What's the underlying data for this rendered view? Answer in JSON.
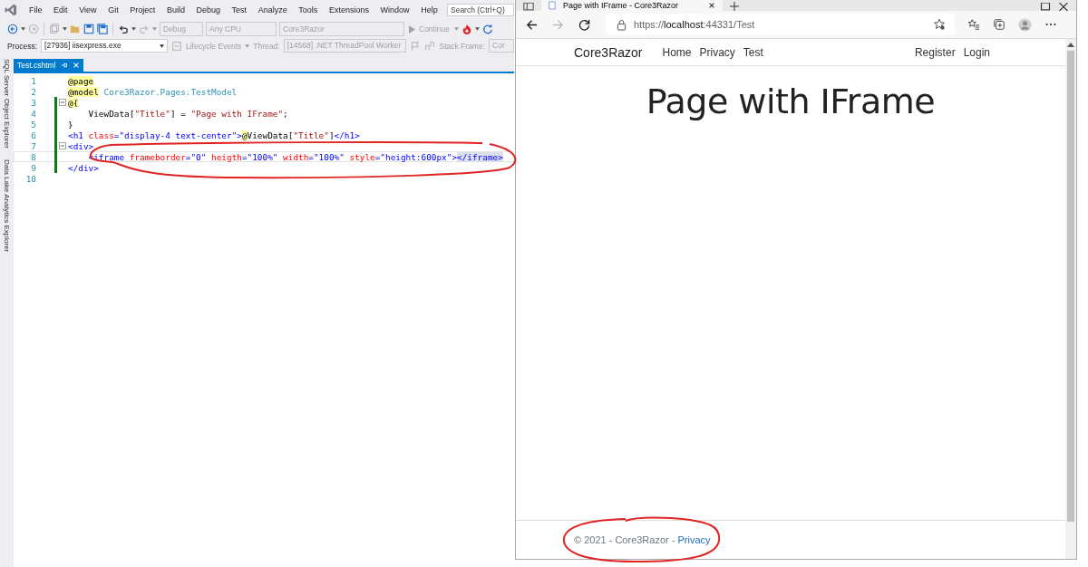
{
  "ide": {
    "menu": [
      "File",
      "Edit",
      "View",
      "Git",
      "Project",
      "Build",
      "Debug",
      "Test",
      "Analyze",
      "Tools",
      "Extensions",
      "Window",
      "Help"
    ],
    "search": {
      "placeholder": "Search (Ctrl+Q)"
    },
    "toolbar": {
      "dropdowns": [
        {
          "label": "Debug",
          "disabled": true
        },
        {
          "label": "Any CPU",
          "disabled": true
        },
        {
          "label": "Core3Razor",
          "disabled": true
        }
      ],
      "continue": {
        "label": "Continue",
        "disabled": true
      }
    },
    "debug_bar": {
      "process_label": "Process:",
      "process": "[27936] iisexpress.exe",
      "lifecycle": "Lifecycle Events",
      "thread_label": "Thread:",
      "thread": "[14568] .NET ThreadPool Worker",
      "stack_label": "Stack Frame:",
      "stack": "Cor"
    },
    "side_panels": [
      "SQL Server Object Explorer",
      "Data Lake Analytics Explorer"
    ],
    "tabs": [
      {
        "label": "Test.cshtml",
        "selected": true
      }
    ],
    "lines": [
      {
        "number": "1",
        "modified": false,
        "fold": false,
        "current": false,
        "tokens": [
          {
            "text": "@page",
            "kind": "razor"
          }
        ]
      },
      {
        "number": "2",
        "modified": false,
        "fold": false,
        "current": false,
        "tokens": [
          {
            "text": "@model",
            "kind": "razor"
          },
          {
            "text": " Core3Razor.Pages.TestModel",
            "kind": "type"
          }
        ]
      },
      {
        "number": "3",
        "modified": true,
        "fold": true,
        "current": false,
        "tokens": [
          {
            "text": "@{",
            "kind": "razor"
          }
        ]
      },
      {
        "number": "4",
        "modified": true,
        "fold": false,
        "current": false,
        "tokens": [
          {
            "text": "    ViewData[",
            "kind": "plain"
          },
          {
            "text": "\"Title\"",
            "kind": "string"
          },
          {
            "text": "] = ",
            "kind": "plain"
          },
          {
            "text": "\"Page with IFrame\"",
            "kind": "string"
          },
          {
            "text": ";",
            "kind": "plain"
          }
        ]
      },
      {
        "number": "5",
        "modified": true,
        "fold": false,
        "current": false,
        "tokens": [
          {
            "text": "}",
            "kind": "plain"
          }
        ]
      },
      {
        "number": "6",
        "modified": true,
        "fold": false,
        "current": false,
        "tokens": [
          {
            "text": "<h1 ",
            "kind": "tag"
          },
          {
            "text": "class",
            "kind": "attr"
          },
          {
            "text": "=\"display-4 text-center\">",
            "kind": "tag"
          },
          {
            "text": "@",
            "kind": "razor"
          },
          {
            "text": "ViewData[",
            "kind": "plain"
          },
          {
            "text": "\"Title\"",
            "kind": "string"
          },
          {
            "text": "]",
            "kind": "plain"
          },
          {
            "text": "</h1>",
            "kind": "tag"
          }
        ]
      },
      {
        "number": "7",
        "modified": true,
        "fold": true,
        "current": false,
        "tokens": [
          {
            "text": "<div>",
            "kind": "tag"
          }
        ]
      },
      {
        "number": "8",
        "modified": true,
        "fold": false,
        "current": true,
        "tokens": [
          {
            "text": "    <iframe ",
            "kind": "tag"
          },
          {
            "text": "frameborder",
            "kind": "attr"
          },
          {
            "text": "=\"0\" ",
            "kind": "tag"
          },
          {
            "text": "heigth",
            "kind": "attr"
          },
          {
            "text": "=\"100%\" ",
            "kind": "tag"
          },
          {
            "text": "width",
            "kind": "attr"
          },
          {
            "text": "=\"100%\" ",
            "kind": "tag"
          },
          {
            "text": "style",
            "kind": "attr"
          },
          {
            "text": "=\"height:600px\">",
            "kind": "tag"
          },
          {
            "text": "</iframe>",
            "kind": "match"
          }
        ]
      },
      {
        "number": "9",
        "modified": true,
        "fold": false,
        "current": false,
        "tokens": [
          {
            "text": "</div>",
            "kind": "tag"
          }
        ]
      },
      {
        "number": "10",
        "modified": false,
        "fold": false,
        "current": false
      }
    ]
  },
  "browser": {
    "tab_title": "Page with IFrame - Core3Razor",
    "url_scheme": "https://",
    "url_host": "localhost",
    "url_path": ":44331/Test",
    "brand": "Core3Razor",
    "nav": [
      "Home",
      "Privacy",
      "Test"
    ],
    "nav_right": [
      "Register",
      "Login"
    ],
    "heading": "Page with IFrame",
    "footer": "© 2021 - Core3Razor - ",
    "footer_link": "Privacy"
  }
}
